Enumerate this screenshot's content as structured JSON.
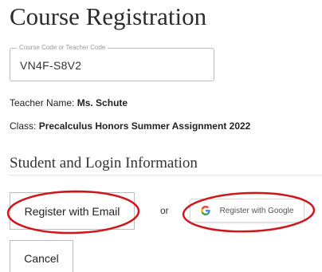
{
  "page": {
    "title": "Course Registration"
  },
  "code_field": {
    "label": "Course Code or Teacher Code",
    "value": "VN4F-S8V2"
  },
  "teacher": {
    "label": "Teacher Name:",
    "value": "Ms. Schute"
  },
  "class_info": {
    "label": "Class:",
    "value": "Precalculus Honors Summer Assignment 2022"
  },
  "section": {
    "title": "Student and Login Information"
  },
  "actions": {
    "register_email": "Register with Email",
    "or": "or",
    "register_google": "Register with Google",
    "cancel": "Cancel"
  },
  "icons": {
    "google": "google-g-icon"
  },
  "colors": {
    "annotation_circle": "#d0151b",
    "google_blue": "#4285F4",
    "google_red": "#EA4335",
    "google_yellow": "#FBBC05",
    "google_green": "#34A853"
  }
}
